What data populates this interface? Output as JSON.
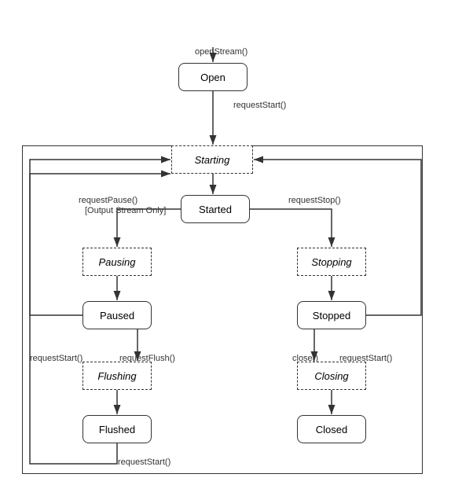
{
  "states": {
    "open": {
      "label": "Open"
    },
    "starting": {
      "label": "Starting"
    },
    "started": {
      "label": "Started"
    },
    "pausing": {
      "label": "Pausing"
    },
    "paused": {
      "label": "Paused"
    },
    "flushing": {
      "label": "Flushing"
    },
    "flushed": {
      "label": "Flushed"
    },
    "stopping": {
      "label": "Stopping"
    },
    "stopped": {
      "label": "Stopped"
    },
    "closing": {
      "label": "Closing"
    },
    "closed": {
      "label": "Closed"
    }
  },
  "transitions": {
    "openStream": "openStream()",
    "requestStart1": "requestStart()",
    "requestPause": "requestPause()",
    "outputStreamOnly": "[Output Stream Only]",
    "requestStop": "requestStop()",
    "requestFlush": "requestFlush()",
    "requestStart2": "requestStart()",
    "requestStart3": "requestStart()",
    "close": "close()",
    "requestStart4": "requestStart()"
  }
}
